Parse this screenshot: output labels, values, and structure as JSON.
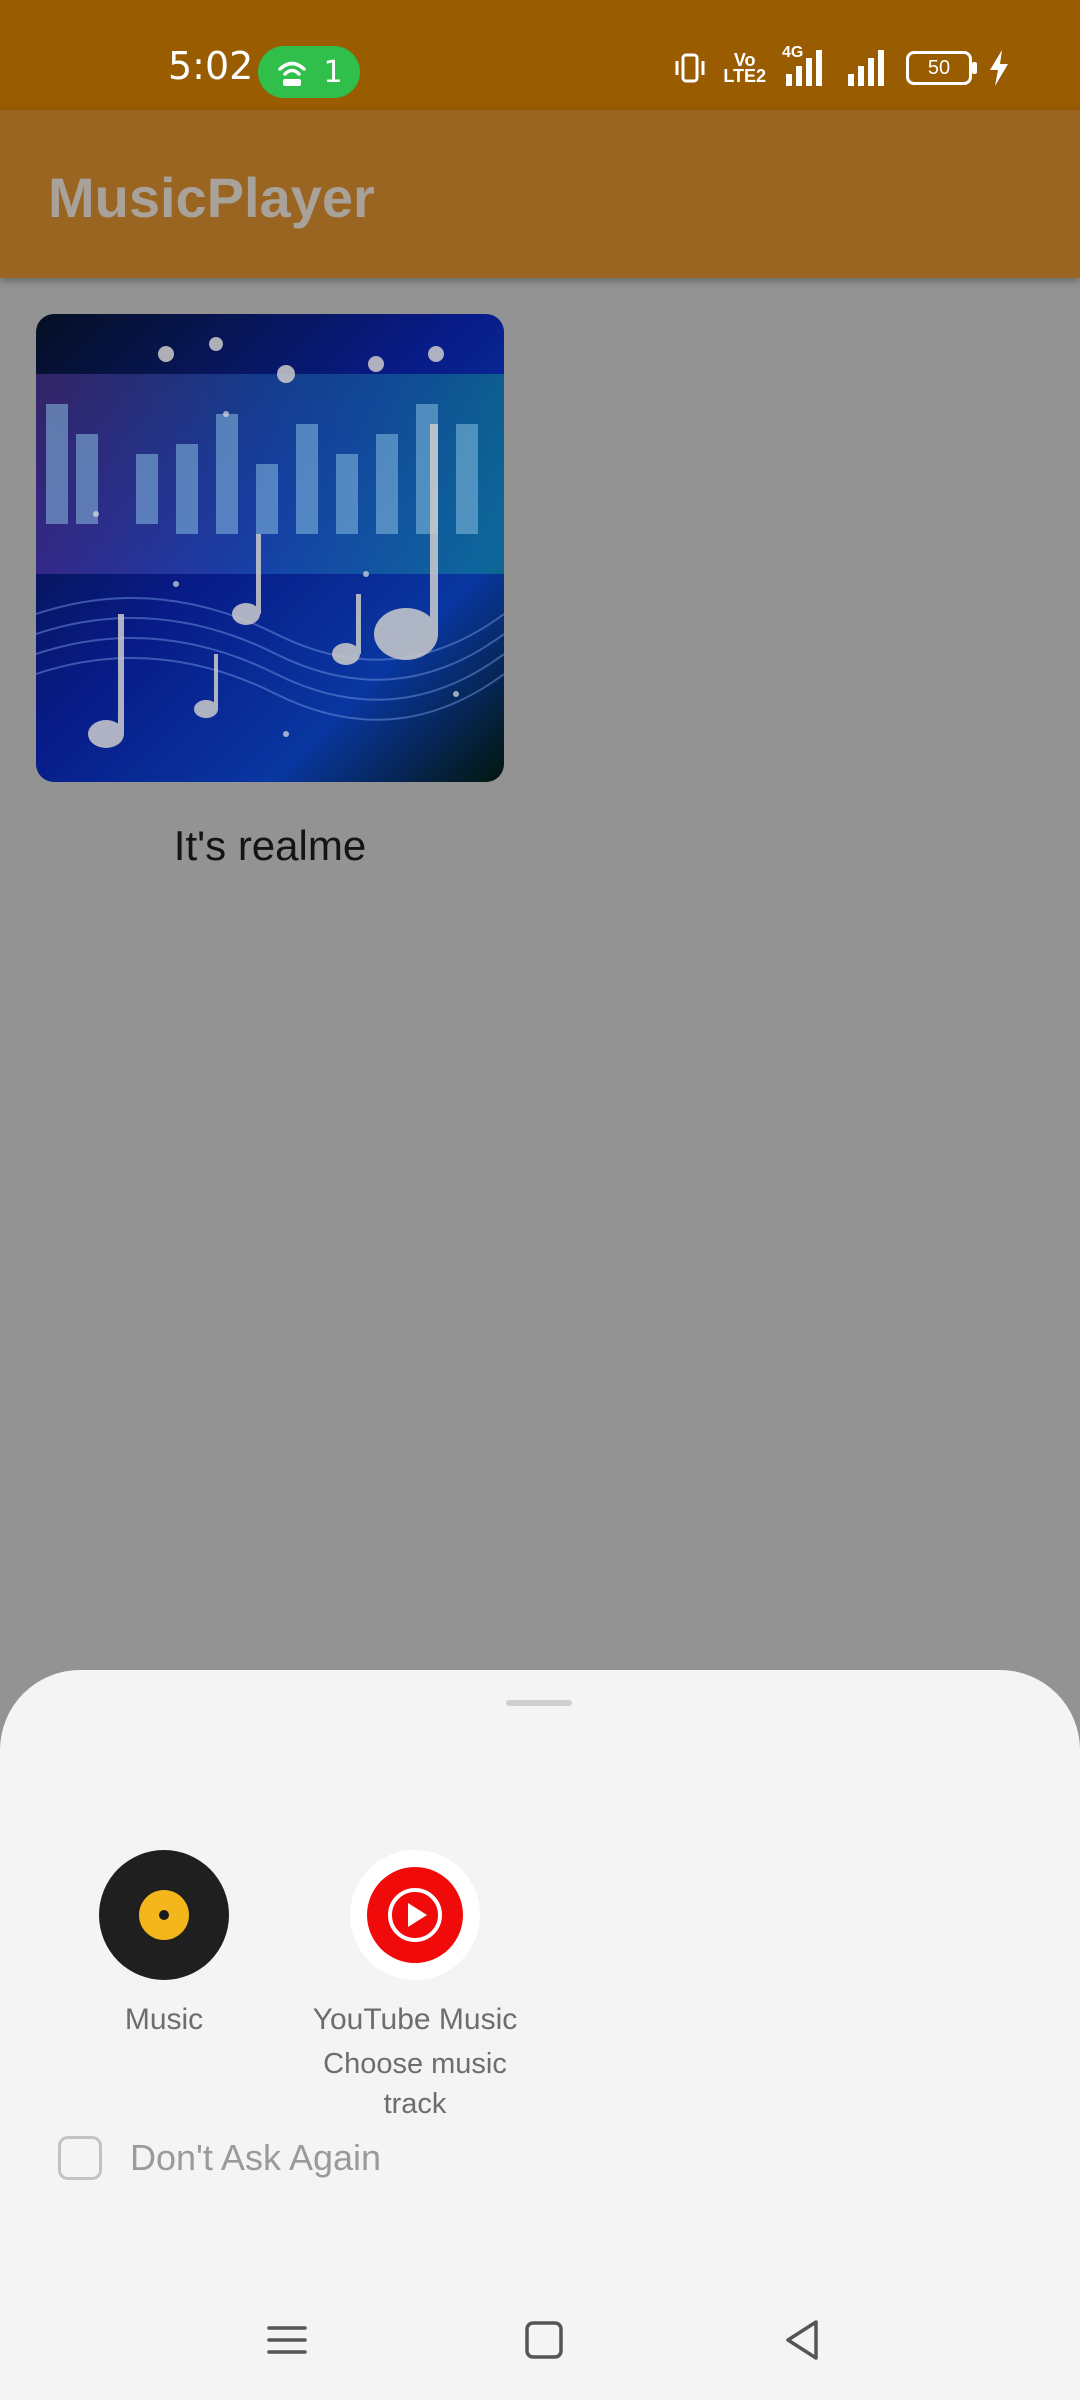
{
  "status_bar": {
    "time": "5:02",
    "hotspot_count": "1",
    "network_vo": "Vo",
    "network_lte": "LTE2",
    "network_type": "4G",
    "battery_level": "50"
  },
  "app_bar": {
    "title": "MusicPlayer"
  },
  "content": {
    "card": {
      "title": "It's realme"
    }
  },
  "sheet": {
    "options": [
      {
        "label": "Music",
        "icon": "music-disc-icon"
      },
      {
        "label": "YouTube Music",
        "sublabel": "Choose music track",
        "icon": "youtube-music-icon"
      }
    ],
    "checkbox_label": "Don't Ask Again",
    "checkbox_checked": false
  },
  "nav_bar": {
    "icons": [
      "menu-icon",
      "home-icon",
      "back-icon"
    ]
  },
  "colors": {
    "status_bar": "#995c00",
    "app_bar": "#9a6421",
    "scrim": "#939393",
    "sheet": "#f4f4f4",
    "youtube_red": "#f10a0a",
    "music_yellow": "#f3b61b"
  }
}
